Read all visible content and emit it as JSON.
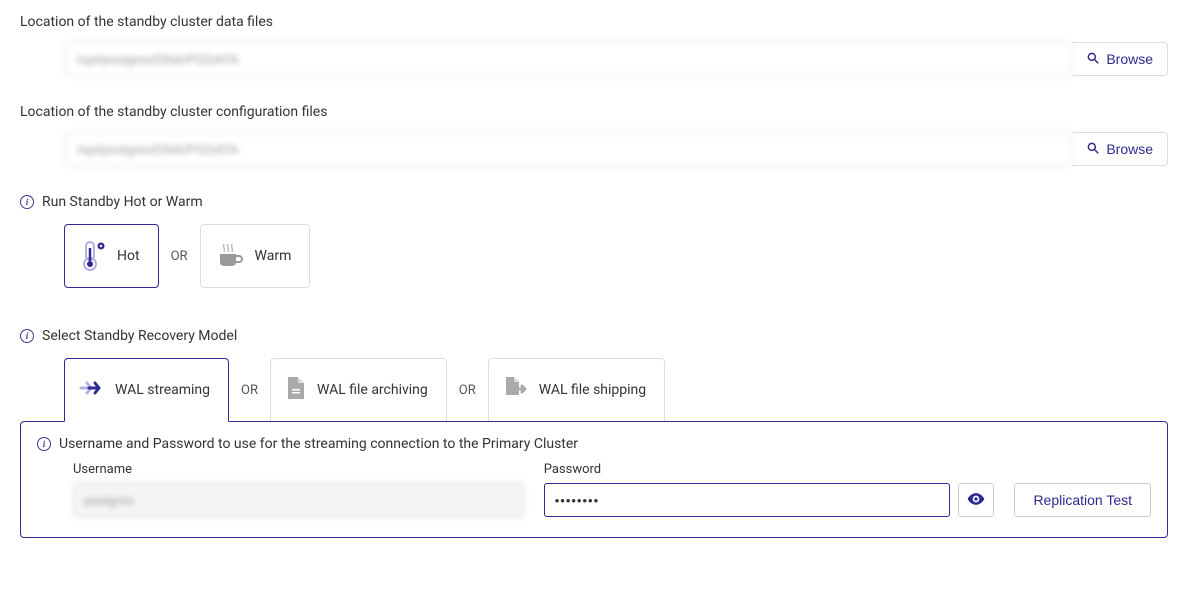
{
  "dataFiles": {
    "label": "Location of the standby cluster data files",
    "value": "/opt/postgres/DNA/PGDATA",
    "browse": "Browse"
  },
  "configFiles": {
    "label": "Location of the standby cluster configuration files",
    "value": "/opt/postgres/DNA/PGDATA",
    "browse": "Browse"
  },
  "standbyMode": {
    "title": "Run Standby Hot or Warm",
    "hot": "Hot",
    "warm": "Warm",
    "or": "OR"
  },
  "recoveryModel": {
    "title": "Select Standby Recovery Model",
    "streaming": "WAL streaming",
    "archiving": "WAL file archiving",
    "shipping": "WAL file shipping",
    "or": "OR"
  },
  "credentials": {
    "title": "Username and Password to use for the streaming connection to the Primary Cluster",
    "usernameLabel": "Username",
    "usernameValue": "postgres",
    "passwordLabel": "Password",
    "passwordValue": "••••••••",
    "replicationTest": "Replication Test"
  }
}
